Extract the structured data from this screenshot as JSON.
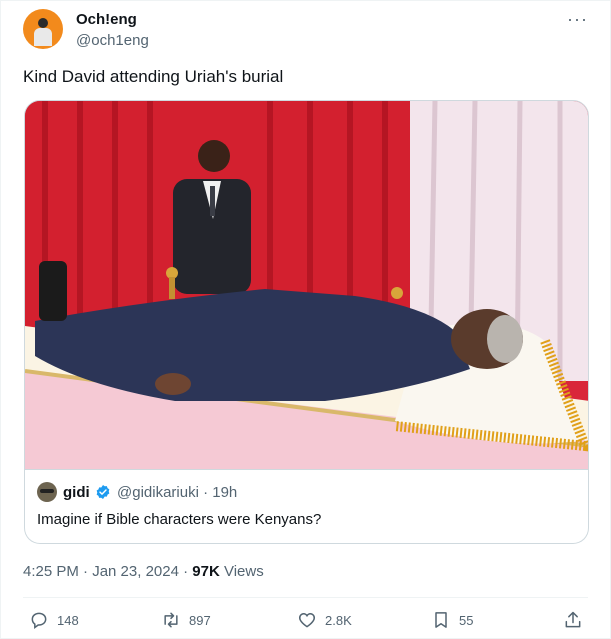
{
  "author": {
    "display_name": "Och!eng",
    "handle": "@och1eng"
  },
  "tweet": {
    "text": "Kind David attending Uriah's burial"
  },
  "quote": {
    "name": "gidi",
    "handle_time": "@gidikariuki · 19h",
    "text": "Imagine if Bible characters were Kenyans?"
  },
  "meta": {
    "time": "4:25 PM · Jan 23, 2024 · ",
    "views_count": "97K",
    "views_label": " Views"
  },
  "actions": {
    "replies": "148",
    "reposts": "897",
    "likes": "2.8K",
    "bookmarks": "55"
  },
  "colors": {
    "verified": "#1d9bf0",
    "text_secondary": "#536471"
  },
  "icons": [
    "more-icon",
    "verified-badge-icon",
    "reply-icon",
    "retweet-icon",
    "like-icon",
    "bookmark-icon",
    "share-icon"
  ]
}
